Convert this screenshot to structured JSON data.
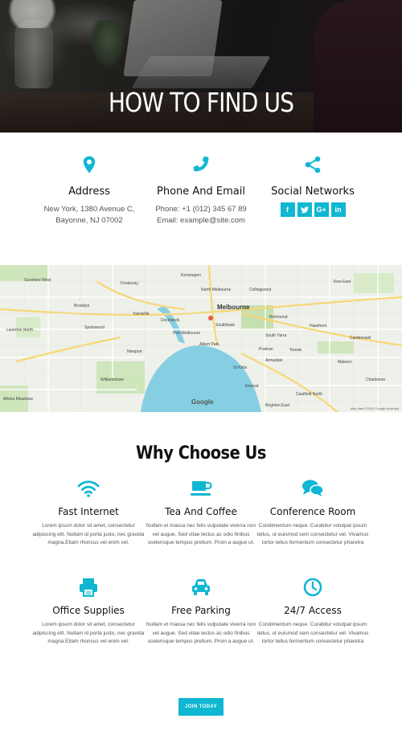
{
  "hero": {
    "title": "HOW TO FIND US"
  },
  "contact": {
    "address": {
      "title": "Address",
      "line1": "New York, 1380 Avenue C,",
      "line2": "Bayonne, NJ 07002",
      "icon": "map-pin-icon"
    },
    "phone": {
      "title": "Phone And Email",
      "line1": "Phone: +1 (012) 345 67 89",
      "line2": "Email: example@site.com",
      "icon": "phone-icon"
    },
    "social": {
      "title": "Social Networks",
      "icon": "share-icon",
      "buttons": [
        {
          "label": "f",
          "icon": "facebook-icon"
        },
        {
          "label": "t",
          "icon": "twitter-icon"
        },
        {
          "label": "G+",
          "icon": "google-plus-icon"
        },
        {
          "label": "in",
          "icon": "linkedin-icon"
        }
      ]
    }
  },
  "map": {
    "city": "Melbourne",
    "labels": [
      "Sunshine West",
      "Footscray",
      "Kensington",
      "North Melbourne",
      "Collingwood",
      "Kew East",
      "Brooklyn",
      "Yarraville",
      "Spotswood",
      "Williamstown",
      "Newport",
      "Laverton North",
      "Altona Meadows",
      "Port Melbourne",
      "Southbank",
      "South Yarra",
      "Prahran",
      "Richmond",
      "Hawthorn",
      "Toorak",
      "Malvern",
      "Caulfield North",
      "St Kilda",
      "Elwood",
      "Brighton East",
      "Camberwell",
      "Chadstone",
      "Armadale",
      "Albert Park",
      "Docklands"
    ],
    "logo": "Google",
    "credits": "Map data ©2019 Google   Australia"
  },
  "why": {
    "title": "Why Choose Us",
    "features": [
      {
        "title": "Fast Internet",
        "icon": "wifi-icon",
        "text": "Lorem ipsum dolor sit amet, consectetur adipiscing elit. Nullam id porta justo, nec gravida magna.Etiam rhoncus vel enim vel."
      },
      {
        "title": "Tea And Coffee",
        "icon": "coffee-cup-icon",
        "text": "Nullam et massa nec felis vulputate viverra non vel augue. Sed vitae lectus ac odio finibus scelerisque tempus pretium. Proin a augue ut."
      },
      {
        "title": "Conference Room",
        "icon": "chat-bubbles-icon",
        "text": "Condimentum neque. Curabitur volutpat ipsum tellus, ut euismod sem consectetur vel. Vivamus tortor tellus fermentum consectetur pharetra"
      },
      {
        "title": "Office Supplies",
        "icon": "printer-icon",
        "text": "Lorem ipsum dolor sit amet, consectetur adipiscing elit. Nullam id porta justo, nec gravida magna.Etiam rhoncus vel enim vel."
      },
      {
        "title": "Free Parking",
        "icon": "car-icon",
        "text": "Nullam et massa nec felis vulputate viverra non vel augue. Sed vitae lectus ac odio finibus scelerisque tempus pretium. Proin a augue ut."
      },
      {
        "title": "24/7 Access",
        "icon": "clock-icon",
        "text": "Condimentum neque. Curabitur volutpat ipsum tellus, ut euismod sem consectetur vel. Vivamus tortor tellus fermentum consectetur pharetra"
      }
    ]
  },
  "cta": {
    "label": "JOIN TODAY"
  },
  "colors": {
    "accent": "#10b7d2"
  }
}
